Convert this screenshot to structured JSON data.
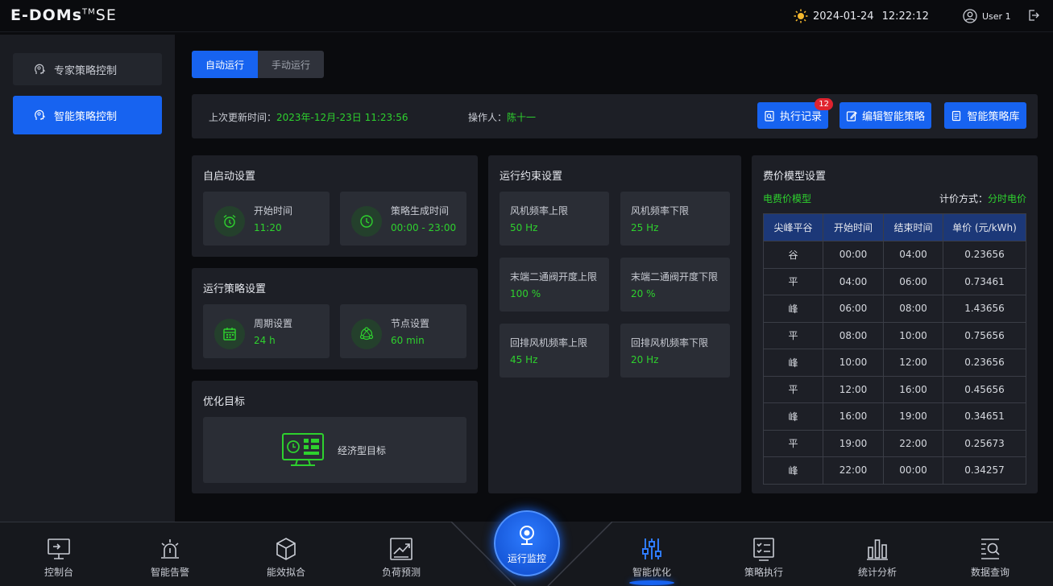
{
  "header": {
    "logo": "E-DOMs",
    "logo_tm": "TM",
    "logo_suffix": "SE",
    "date": "2024-01-24",
    "time": "12:22:12",
    "user": "User 1"
  },
  "sidebar": {
    "items": [
      {
        "label": "专家策略控制",
        "active": false
      },
      {
        "label": "智能策略控制",
        "active": true
      }
    ]
  },
  "tabs": [
    {
      "label": "自动运行",
      "active": true
    },
    {
      "label": "手动运行",
      "active": false
    }
  ],
  "info": {
    "update_label": "上次更新时间：",
    "update_value": "2023年-12月-23日 11:23:56",
    "operator_label": "操作人：",
    "operator_value": "陈十一"
  },
  "actions": {
    "exec_log": "执行记录",
    "exec_badge": "12",
    "edit_strategy": "编辑智能策略",
    "strategy_lib": "智能策略库"
  },
  "auto_start": {
    "title": "自启动设置",
    "start_label": "开始时间",
    "start_value": "11:20",
    "gen_label": "策略生成时间",
    "gen_value": "00:00 - 23:00"
  },
  "run_strategy": {
    "title": "运行策略设置",
    "period_label": "周期设置",
    "period_value": "24 h",
    "node_label": "节点设置",
    "node_value": "60 min"
  },
  "optimize": {
    "title": "优化目标",
    "target": "经济型目标"
  },
  "constraints": {
    "title": "运行约束设置",
    "items": [
      {
        "label": "风机频率上限",
        "value": "50 Hz"
      },
      {
        "label": "风机频率下限",
        "value": "25 Hz"
      },
      {
        "label": "末端二通阀开度上限",
        "value": "100 %"
      },
      {
        "label": "末端二通阀开度下限",
        "value": "20 %"
      },
      {
        "label": "回排风机频率上限",
        "value": "45 Hz"
      },
      {
        "label": "回排风机频率下限",
        "value": "20 Hz"
      }
    ]
  },
  "price": {
    "title": "费价模型设置",
    "model": "电费价模型",
    "mode_label": "计价方式：",
    "mode_value": "分时电价",
    "headers": [
      "尖峰平谷",
      "开始时间",
      "结束时间",
      "单价 (元/kWh)"
    ],
    "rows": [
      [
        "谷",
        "00:00",
        "04:00",
        "0.23656"
      ],
      [
        "平",
        "04:00",
        "06:00",
        "0.73461"
      ],
      [
        "峰",
        "06:00",
        "08:00",
        "1.43656"
      ],
      [
        "平",
        "08:00",
        "10:00",
        "0.75656"
      ],
      [
        "峰",
        "10:00",
        "12:00",
        "0.23656"
      ],
      [
        "平",
        "12:00",
        "16:00",
        "0.45656"
      ],
      [
        "峰",
        "16:00",
        "19:00",
        "0.34651"
      ],
      [
        "平",
        "19:00",
        "22:00",
        "0.25673"
      ],
      [
        "峰",
        "22:00",
        "00:00",
        "0.34257"
      ]
    ]
  },
  "bottom_nav": {
    "items": [
      {
        "label": "控制台"
      },
      {
        "label": "智能告警"
      },
      {
        "label": "能效拟合"
      },
      {
        "label": "负荷预测"
      },
      {
        "label": "运行监控"
      },
      {
        "label": "智能优化"
      },
      {
        "label": "策略执行"
      },
      {
        "label": "统计分析"
      },
      {
        "label": "数据查询"
      }
    ]
  },
  "colors": {
    "accent": "#1763f0",
    "value_green": "#2ed12e",
    "badge_red": "#e0232f"
  }
}
